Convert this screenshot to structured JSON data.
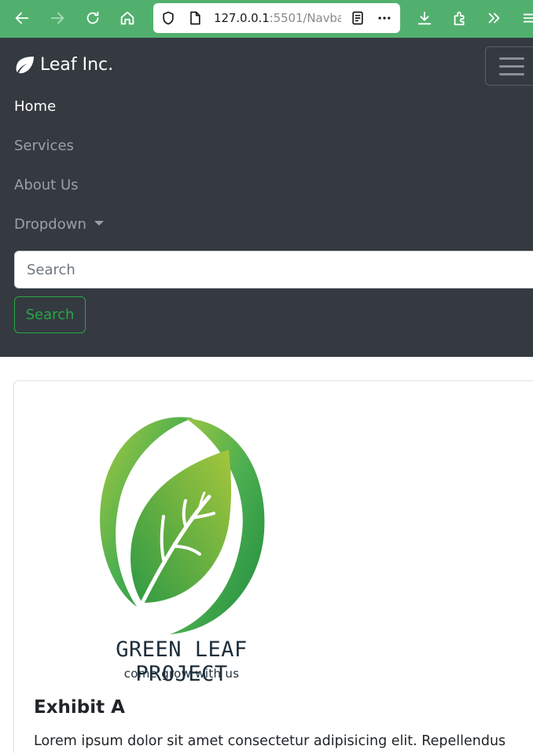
{
  "browser": {
    "url_host": "127.0.0.1",
    "url_rest": ":5501/Navba",
    "icons": [
      "back-arrow-icon",
      "forward-arrow-icon",
      "reload-icon",
      "home-icon",
      "shield-icon",
      "page-icon",
      "reader-view-icon",
      "more-icon",
      "download-icon",
      "extensions-icon",
      "overflow-icon",
      "menu-icon"
    ]
  },
  "navbar": {
    "brand": "Leaf Inc.",
    "links": [
      {
        "label": "Home",
        "active": true
      },
      {
        "label": "Services"
      },
      {
        "label": "About Us"
      },
      {
        "label": "Dropdown"
      }
    ],
    "search_placeholder": "Search",
    "search_button": "Search",
    "colors": {
      "background": "#343a40",
      "accent": "#28a745"
    }
  },
  "card": {
    "logo_title": "GREEN LEAF PROJECT",
    "logo_subtitle": "come grow with us",
    "title": "Exhibit A",
    "text": "Lorem ipsum dolor sit amet consectetur adipisicing elit. Repellendus"
  },
  "colors": {
    "browser_toolbar": "#52b06e",
    "leaf_green": "#4caf50",
    "leaf_light": "#a4c63c"
  }
}
